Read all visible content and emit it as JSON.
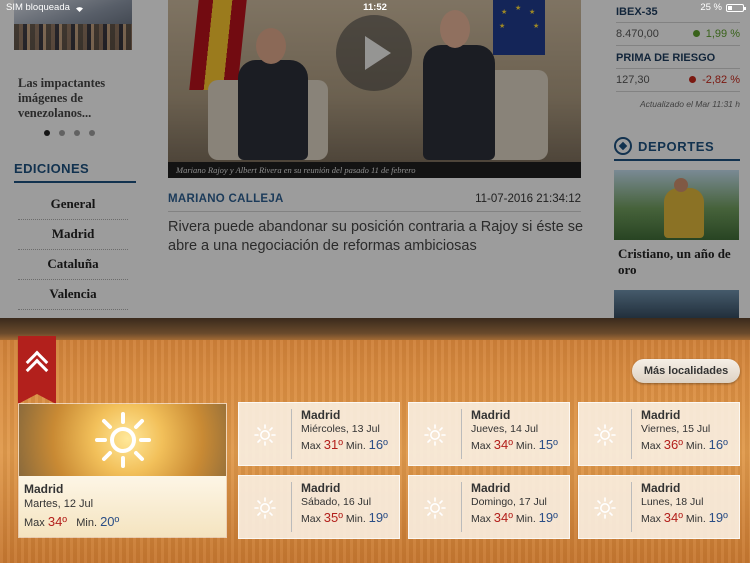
{
  "status_bar": {
    "carrier": "SIM bloqueada",
    "time": "11:52",
    "battery": "25 %"
  },
  "left_column": {
    "caption": "Las impactantes imágenes de venezolanos...",
    "ediciones_title": "EDICIONES",
    "editions": [
      "General",
      "Madrid",
      "Cataluña",
      "Valencia"
    ]
  },
  "article": {
    "video_caption": "Mariano Rajoy y Albert Rivera en su reunión del pasado 11 de febrero",
    "author": "MARIANO CALLEJA",
    "datetime": "11-07-2016 21:34:12",
    "headline": "Rivera puede abandonar su posición contraria a Rajoy si éste se abre a una negociación de reformas ambiciosas"
  },
  "markets": {
    "items": [
      {
        "name": "IBEX-35",
        "value": "8.470,00",
        "change": "1,99 %",
        "color": "#5a9a2a"
      },
      {
        "name": "PRIMA DE RIESGO",
        "value": "127,30",
        "change": "-2,82 %",
        "color": "#c0281c"
      }
    ],
    "updated": "Actualizado el Mar 11:31 h"
  },
  "sports": {
    "title": "DEPORTES",
    "caption": "Cristiano, un año de oro"
  },
  "weather": {
    "more_button": "Más localidades",
    "labels": {
      "max": "Max",
      "min": "Min."
    },
    "today": {
      "city": "Madrid",
      "date": "Martes, 12 Jul",
      "max": "34º",
      "min": "20º"
    },
    "forecast": [
      {
        "city": "Madrid",
        "date": "Miércoles, 13 Jul",
        "max": "31º",
        "min": "16º"
      },
      {
        "city": "Madrid",
        "date": "Jueves, 14 Jul",
        "max": "34º",
        "min": "15º"
      },
      {
        "city": "Madrid",
        "date": "Viernes, 15 Jul",
        "max": "36º",
        "min": "16º"
      },
      {
        "city": "Madrid",
        "date": "Sábado, 16 Jul",
        "max": "35º",
        "min": "19º"
      },
      {
        "city": "Madrid",
        "date": "Domingo, 17 Jul",
        "max": "34º",
        "min": "19º"
      },
      {
        "city": "Madrid",
        "date": "Lunes, 18 Jul",
        "max": "34º",
        "min": "19º"
      }
    ],
    "colors": {
      "max": "#b3201c",
      "min": "#2b4e86",
      "ribbon": "#b2201c"
    }
  }
}
